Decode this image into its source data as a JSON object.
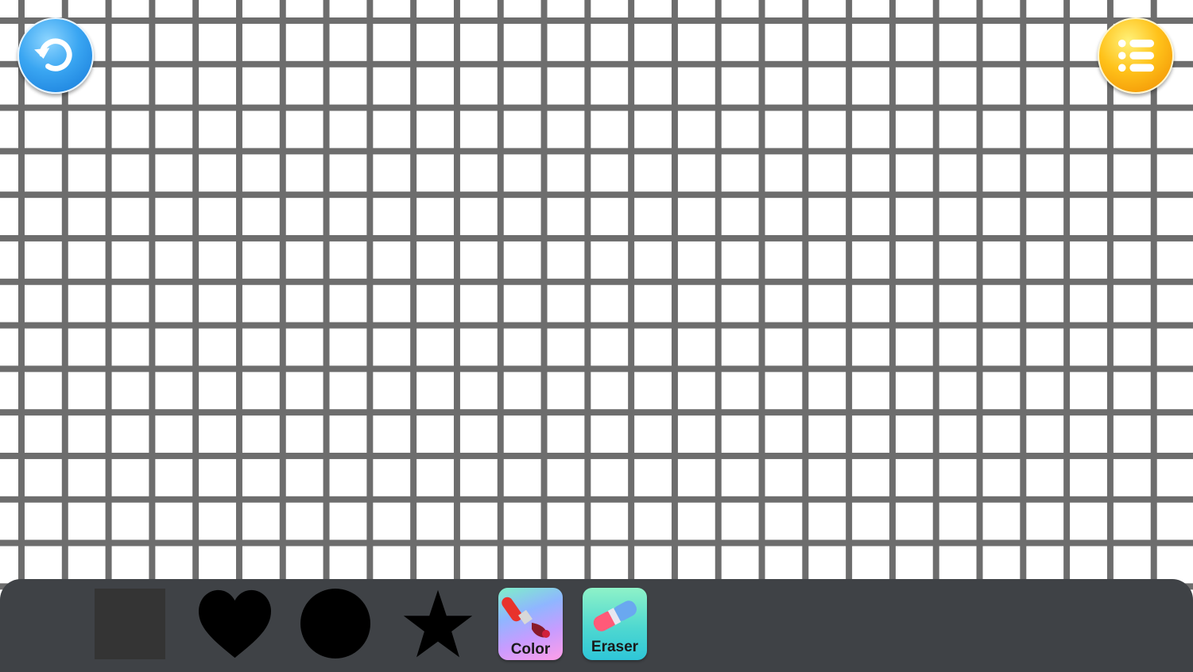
{
  "top_controls": {
    "restart_icon": "restart-arrow-icon",
    "menu_icon": "list-menu-icon",
    "restart_color": "#2f95ea",
    "menu_color": "#ffbe16"
  },
  "canvas": {
    "background": "#ffffff",
    "grid_line_color": "#6d6d6d"
  },
  "toolbar": {
    "background": "#3f4246",
    "shapes": [
      {
        "name": "square",
        "icon": "square-shape-icon",
        "color": "#343434"
      },
      {
        "name": "heart",
        "icon": "heart-shape-icon",
        "color": "#000000"
      },
      {
        "name": "circle",
        "icon": "circle-shape-icon",
        "color": "#000000"
      },
      {
        "name": "star",
        "icon": "star-shape-icon",
        "color": "#000000"
      }
    ],
    "color_tool": {
      "label": "Color",
      "icon": "paint-brush-icon"
    },
    "eraser_tool": {
      "label": "Eraser",
      "icon": "eraser-icon"
    }
  }
}
